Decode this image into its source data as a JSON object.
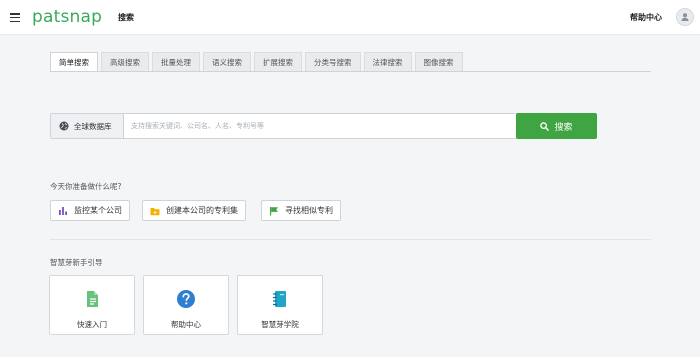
{
  "header": {
    "logo_text": "patsnap",
    "nav_search": "搜索",
    "help_center": "帮助中心"
  },
  "tabs": [
    {
      "label": "简单搜索",
      "active": true
    },
    {
      "label": "高级搜索"
    },
    {
      "label": "批量处理"
    },
    {
      "label": "语义搜索"
    },
    {
      "label": "扩展搜索"
    },
    {
      "label": "分类号搜索"
    },
    {
      "label": "法律搜索"
    },
    {
      "label": "图像搜索"
    }
  ],
  "search": {
    "database_label": "全球数据库",
    "placeholder": "支持搜索关键词、公司名、人名、专利号等",
    "button_label": "搜索"
  },
  "prompt": {
    "title": "今天你准备做什么呢?",
    "actions": [
      {
        "label": "监控某个公司",
        "icon": "bar-chart-icon",
        "color": "#7b4fc4"
      },
      {
        "label": "创建本公司的专利集",
        "icon": "folder-icon",
        "color": "#f0b400"
      },
      {
        "label": "寻找相似专利",
        "icon": "flag-icon",
        "color": "#3fa542"
      }
    ]
  },
  "guide": {
    "title": "智慧芽新手引导",
    "cards": [
      {
        "label": "快速入门",
        "icon": "document-icon",
        "color": "#67c27c"
      },
      {
        "label": "帮助中心",
        "icon": "question-icon",
        "color": "#2f7fd0"
      },
      {
        "label": "智慧芽学院",
        "icon": "notebook-icon",
        "color": "#1fa5c9"
      }
    ]
  },
  "colors": {
    "brand": "#3ba85e",
    "primary_button": "#3fa542"
  }
}
